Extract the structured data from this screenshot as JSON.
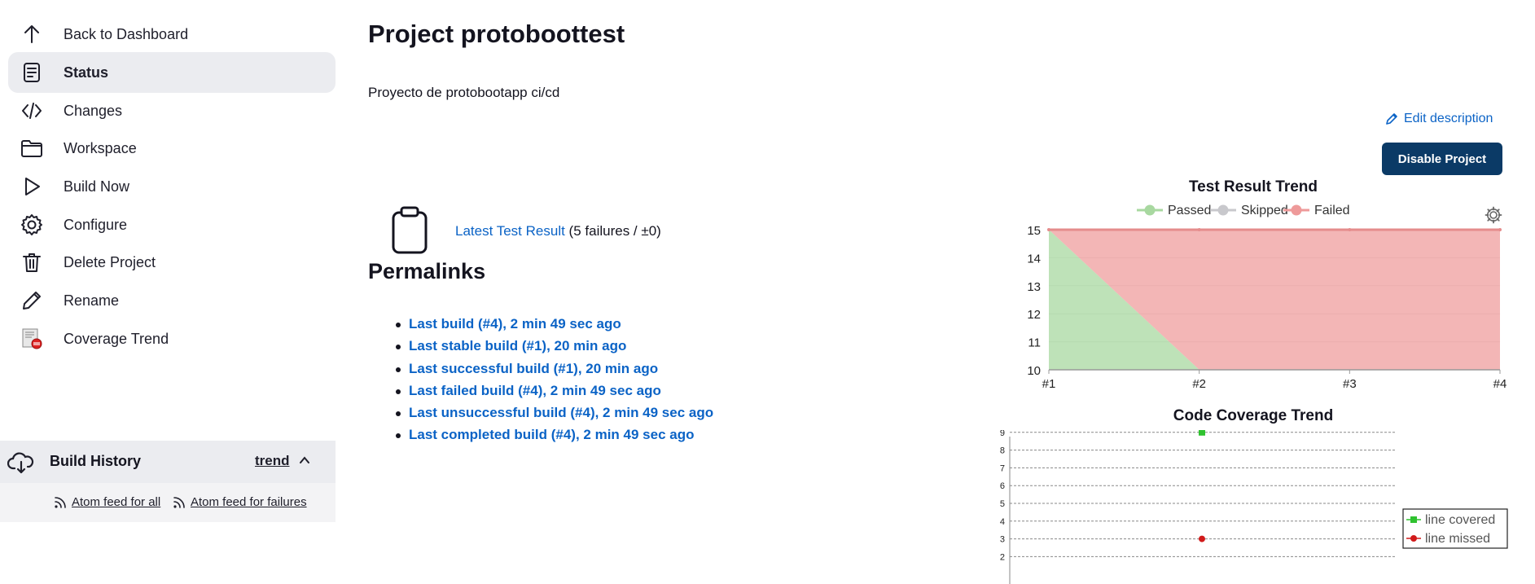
{
  "sidebar": {
    "items": [
      {
        "label": "Back to Dashboard",
        "icon": "arrow-up-icon"
      },
      {
        "label": "Status",
        "icon": "document-icon",
        "active": true
      },
      {
        "label": "Changes",
        "icon": "code-icon"
      },
      {
        "label": "Workspace",
        "icon": "folder-icon"
      },
      {
        "label": "Build Now",
        "icon": "play-icon"
      },
      {
        "label": "Configure",
        "icon": "gear-icon"
      },
      {
        "label": "Delete Project",
        "icon": "trash-icon"
      },
      {
        "label": "Rename",
        "icon": "pencil-icon"
      },
      {
        "label": "Coverage Trend",
        "icon": "coverage-report-icon"
      }
    ]
  },
  "build_history": {
    "title": "Build History",
    "trend_label": "trend",
    "feed_all": "Atom feed for all",
    "feed_failures": "Atom feed for failures"
  },
  "main": {
    "title": "Project protoboottest",
    "description": "Proyecto de protobootapp ci/cd",
    "edit_description": "Edit description",
    "disable_button": "Disable Project",
    "latest_test_link": "Latest Test Result",
    "latest_test_suffix": " (5 failures / ±0)",
    "permalinks_title": "Permalinks",
    "permalinks": [
      "Last build (#4), 2 min 49 sec ago",
      "Last stable build (#1), 20 min ago",
      "Last successful build (#1), 20 min ago",
      "Last failed build (#4), 2 min 49 sec ago",
      "Last unsuccessful build (#4), 2 min 49 sec ago",
      "Last completed build (#4), 2 min 49 sec ago"
    ]
  },
  "colors": {
    "passed": "#a8d8a0",
    "skipped": "#c8c8cc",
    "failed": "#ee9a9a",
    "covered": "#2fc22f",
    "missed": "#d11a1a",
    "link": "#0b63c6"
  },
  "chart_data": [
    {
      "type": "area",
      "title": "Test Result Trend",
      "x": [
        "#1",
        "#2",
        "#3",
        "#4"
      ],
      "ylim": [
        10,
        15
      ],
      "yticks": [
        10,
        11,
        12,
        13,
        14,
        15
      ],
      "series": [
        {
          "name": "Passed",
          "values": [
            15,
            10,
            10,
            10
          ]
        },
        {
          "name": "Skipped",
          "values": [
            0,
            0,
            0,
            0
          ]
        },
        {
          "name": "Failed",
          "values": [
            15,
            15,
            15,
            15
          ]
        }
      ],
      "legend": "top"
    },
    {
      "type": "scatter",
      "title": "Code Coverage Trend",
      "yticks": [
        2,
        3,
        4,
        5,
        6,
        7,
        8,
        9
      ],
      "series": [
        {
          "name": "line covered",
          "values": [
            9
          ]
        },
        {
          "name": "line missed",
          "values": [
            3
          ]
        }
      ],
      "legend": "right"
    }
  ]
}
